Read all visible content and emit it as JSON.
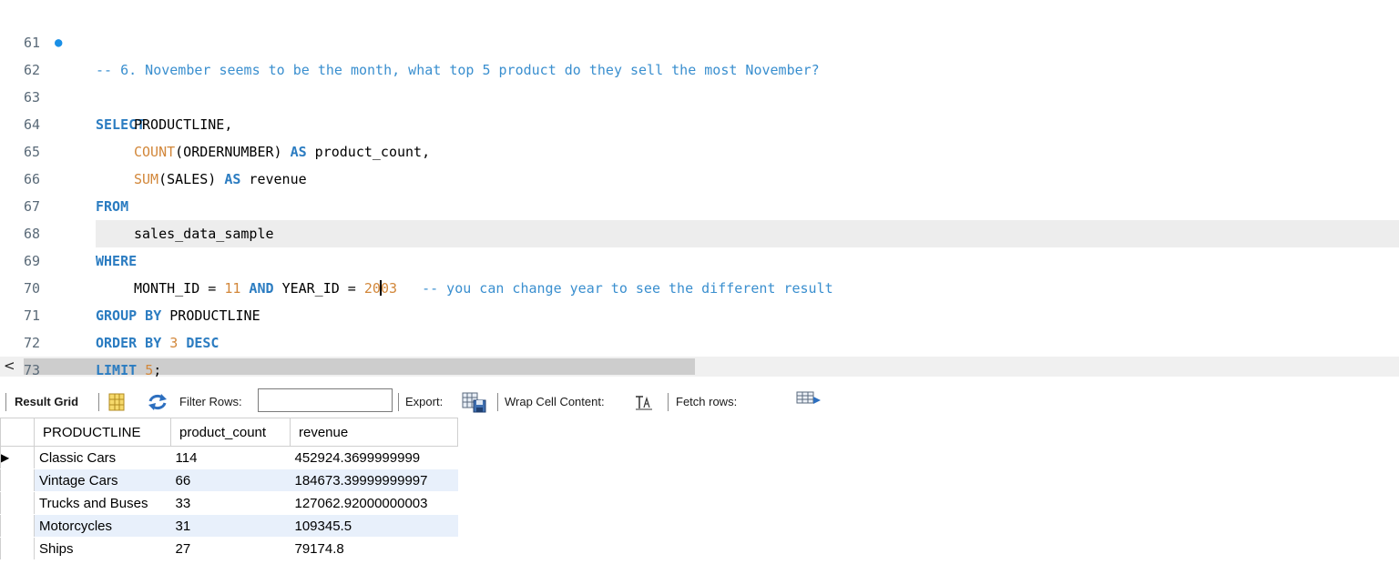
{
  "editor": {
    "lines": [
      {
        "num": "61"
      },
      {
        "num": "62",
        "marker": "●"
      },
      {
        "num": "63"
      },
      {
        "num": "64"
      },
      {
        "num": "65"
      },
      {
        "num": "66"
      },
      {
        "num": "67"
      },
      {
        "num": "68"
      },
      {
        "num": "69"
      },
      {
        "num": "70"
      },
      {
        "num": "71"
      },
      {
        "num": "72"
      },
      {
        "num": "73"
      }
    ],
    "code": {
      "comment_q6": "-- 6. November seems to be the month, what top 5 product do they sell the most November?",
      "select_kw": "SELECT",
      "productline_col": "PRODUCTLINE,",
      "count_fn": "COUNT",
      "count_arg": "(ORDERNUMBER) ",
      "as_kw": "AS",
      "product_count_alias": " product_count,",
      "sum_fn": "SUM",
      "sum_arg": "(SALES) ",
      "revenue_alias": " revenue",
      "from_kw": "FROM",
      "table_name": "sales_data_sample",
      "where_kw": "WHERE",
      "month_id": "MONTH_ID = ",
      "month_val": "11",
      "and_kw": " AND ",
      "year_id": "YEAR_ID = ",
      "year_val_a": "20",
      "year_val_b": "03",
      "comment_year": "   -- you can change year to see the different result",
      "group_by_kw": "GROUP BY",
      "group_by_col": " PRODUCTLINE",
      "order_by_kw": "ORDER BY",
      "order_by_num": "3",
      "desc_kw": "DESC",
      "limit_kw": "LIMIT",
      "limit_num": "5",
      "limit_end": ";"
    }
  },
  "scrollbar": {
    "left_arrow": "<"
  },
  "toolbar": {
    "result_grid_label_bold": "Re",
    "result_grid_label_rest": "sult Grid",
    "filter_rows_label": "Filter Rows:",
    "filter_value": "",
    "export_label": "Export:",
    "wrap_label": "Wrap Cell Content:",
    "fetch_label": "Fetch rows:",
    "icons": [
      "grid-view-icon",
      "refresh-icon",
      "export-icon",
      "wrap-text-icon",
      "fetch-rows-icon"
    ]
  },
  "result": {
    "columns": [
      "PRODUCTLINE",
      "product_count",
      "revenue"
    ],
    "row_pointer": "▶",
    "rows": [
      [
        "Classic Cars",
        "114",
        "452924.3699999999"
      ],
      [
        "Vintage Cars",
        "66",
        "184673.39999999997"
      ],
      [
        "Trucks and Buses",
        "33",
        "127062.92000000003"
      ],
      [
        "Motorcycles",
        "31",
        "109345.5"
      ],
      [
        "Ships",
        "27",
        "79174.8"
      ]
    ]
  },
  "colors": {
    "keyword": "#2b7cc1",
    "function_number": "#d2873a",
    "comment": "#3a8fcf",
    "line_number": "#5a6a78",
    "current_line": "#ededed",
    "alt_row": "#e8f0fb"
  }
}
